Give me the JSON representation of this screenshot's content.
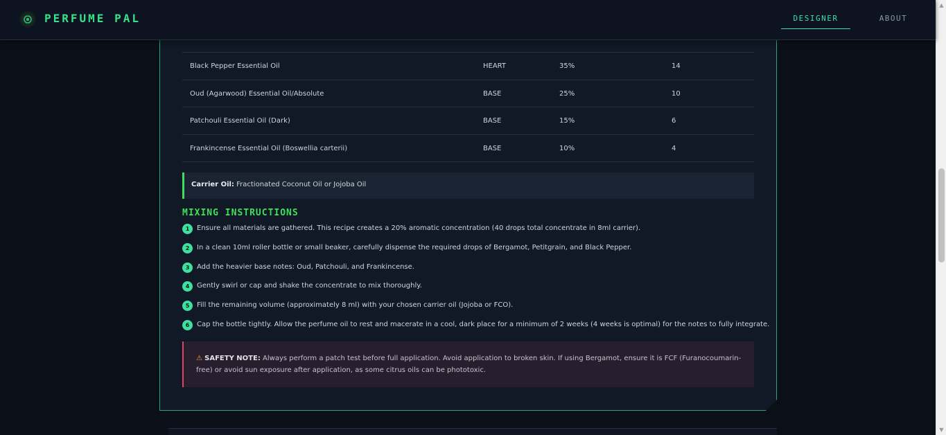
{
  "header": {
    "brand": "PERFUME PAL",
    "nav": {
      "designer": "DESIGNER",
      "about": "ABOUT"
    },
    "active_tab": "designer"
  },
  "ingredients": [
    {
      "name": "Black Pepper Essential Oil",
      "note": "HEART",
      "percent": "35%",
      "drops": "14"
    },
    {
      "name": "Oud (Agarwood) Essential Oil/Absolute",
      "note": "BASE",
      "percent": "25%",
      "drops": "10"
    },
    {
      "name": "Patchouli Essential Oil (Dark)",
      "note": "BASE",
      "percent": "15%",
      "drops": "6"
    },
    {
      "name": "Frankincense Essential Oil (Boswellia carterii)",
      "note": "BASE",
      "percent": "10%",
      "drops": "4"
    }
  ],
  "carrier": {
    "label": "Carrier Oil:",
    "value": "Fractionated Coconut Oil or Jojoba Oil"
  },
  "mixing": {
    "title": "MIXING INSTRUCTIONS",
    "steps": [
      {
        "num": "1",
        "text": "Ensure all materials are gathered. This recipe creates a 20% aromatic concentration (40 drops total concentrate in 8ml carrier)."
      },
      {
        "num": "2",
        "text": "In a clean 10ml roller bottle or small beaker, carefully dispense the required drops of Bergamot, Petitgrain, and Black Pepper."
      },
      {
        "num": "3",
        "text": "Add the heavier base notes: Oud, Patchouli, and Frankincense."
      },
      {
        "num": "4",
        "text": "Gently swirl or cap and shake the concentrate to mix thoroughly."
      },
      {
        "num": "5",
        "text": "Fill the remaining volume (approximately 8 ml) with your chosen carrier oil (Jojoba or FCO)."
      },
      {
        "num": "6",
        "text": "Cap the bottle tightly. Allow the perfume oil to rest and macerate in a cool, dark place for a minimum of 2 weeks (4 weeks is optimal) for the notes to fully integrate."
      }
    ]
  },
  "safety": {
    "label": "SAFETY NOTE:",
    "text": "Always perform a patch test before full application. Avoid application to broken skin. If using Bergamot, ensure it is FCF (Furanocoumarin-free) or avoid sun exposure after application, as some citrus oils can be phototoxic."
  },
  "colors": {
    "accent_green": "#3ee05a",
    "accent_teal": "#3ee0a9",
    "warning_red": "#e0445e",
    "background": "#0b0f17"
  }
}
